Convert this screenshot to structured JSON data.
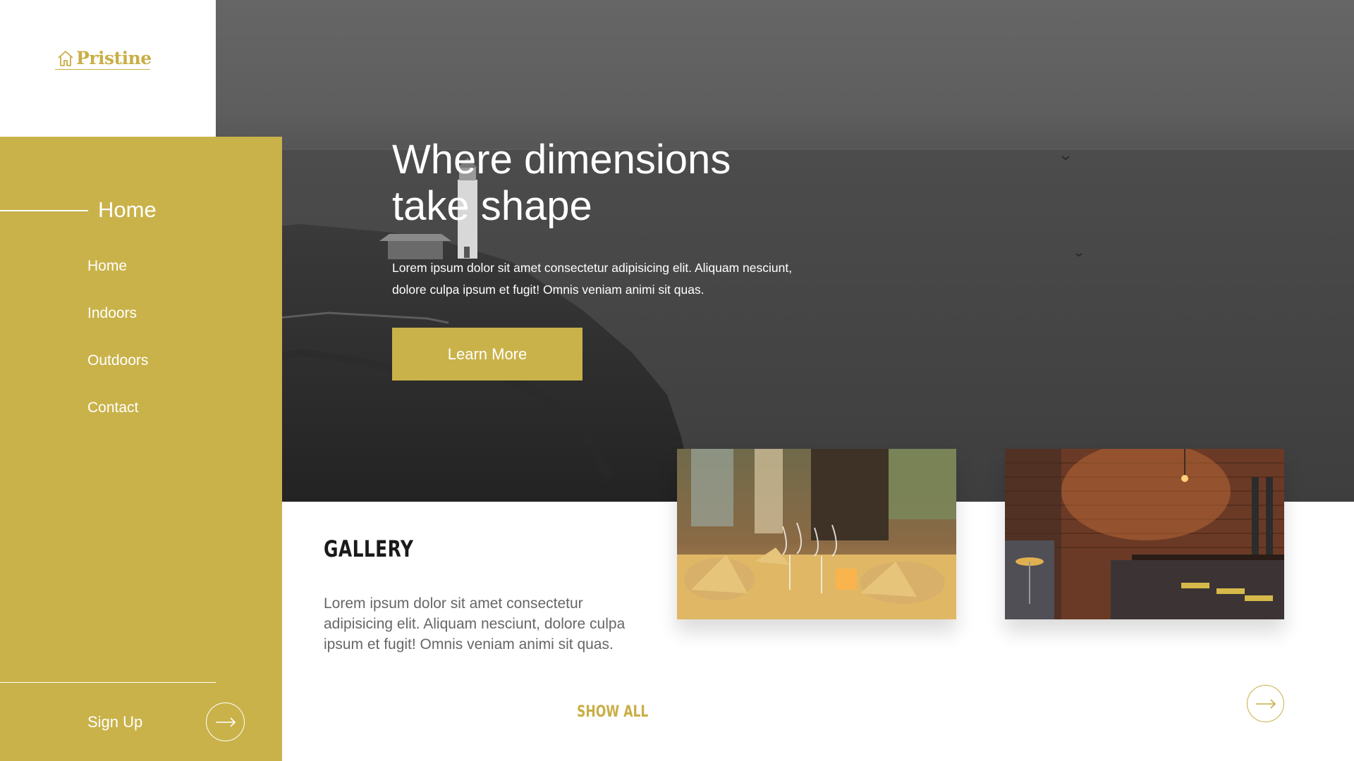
{
  "brand": {
    "name": "Pristine",
    "icon": "house-icon",
    "accent_color": "#c9b249"
  },
  "sidebar": {
    "current_page": "Home",
    "items": [
      {
        "label": "Home"
      },
      {
        "label": "Indoors"
      },
      {
        "label": "Outdoors"
      },
      {
        "label": "Contact"
      }
    ],
    "signup_label": "Sign Up",
    "signup_icon": "arrow-right-icon"
  },
  "hero": {
    "title_line1": "Where dimensions",
    "title_line2": "take shape",
    "description_line1": "Lorem ipsum dolor sit amet consectetur adipisicing elit. Aliquam nesciunt,",
    "description_line2": "dolore culpa ipsum et fugit! Omnis veniam animi sit quas.",
    "button_label": "Learn More"
  },
  "gallery": {
    "title": "GALLERY",
    "description": "Lorem ipsum dolor sit amet consectetur adipisicing elit. Aliquam nesciunt, dolore culpa ipsum et fugit! Omnis veniam animi sit quas.",
    "show_all_label": "SHOW ALL",
    "next_icon": "arrow-right-icon"
  }
}
